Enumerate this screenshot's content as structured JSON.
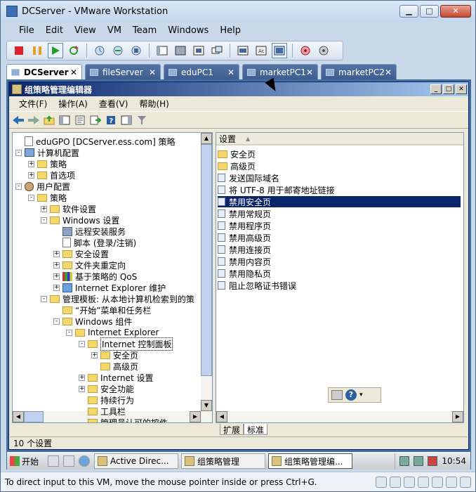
{
  "vmware": {
    "title": "DCServer - VMware Workstation",
    "menu": [
      "File",
      "Edit",
      "View",
      "VM",
      "Team",
      "Windows",
      "Help"
    ],
    "tabs": [
      {
        "label": "DCServer",
        "active": true
      },
      {
        "label": "fileServer",
        "active": false
      },
      {
        "label": "eduPC1",
        "active": false
      },
      {
        "label": "marketPC1",
        "active": false
      },
      {
        "label": "marketPC2",
        "active": false
      }
    ],
    "status_text": "To direct input to this VM, move the mouse pointer inside or press Ctrl+G."
  },
  "mmc": {
    "title": "组策略管理编辑器",
    "menu": [
      "文件(F)",
      "操作(A)",
      "查看(V)",
      "帮助(H)"
    ],
    "tree": [
      {
        "label": "eduGPO [DCServer.ess.com] 策略",
        "level": 0,
        "exp": "",
        "icon": "script"
      },
      {
        "label": "计算机配置",
        "level": 0,
        "exp": "-",
        "icon": "pc"
      },
      {
        "label": "策略",
        "level": 1,
        "exp": "+",
        "icon": "folder"
      },
      {
        "label": "首选项",
        "level": 1,
        "exp": "+",
        "icon": "folder"
      },
      {
        "label": "用户配置",
        "level": 0,
        "exp": "-",
        "icon": "user"
      },
      {
        "label": "策略",
        "level": 1,
        "exp": "-",
        "icon": "folder"
      },
      {
        "label": "软件设置",
        "level": 2,
        "exp": "+",
        "icon": "folder"
      },
      {
        "label": "Windows 设置",
        "level": 2,
        "exp": "-",
        "icon": "folder"
      },
      {
        "label": "远程安装服务",
        "level": 3,
        "exp": "",
        "icon": "gear"
      },
      {
        "label": "脚本 (登录/注销)",
        "level": 3,
        "exp": "",
        "icon": "script"
      },
      {
        "label": "安全设置",
        "level": 3,
        "exp": "+",
        "icon": "folder"
      },
      {
        "label": "文件夹重定向",
        "level": 3,
        "exp": "+",
        "icon": "folder"
      },
      {
        "label": "基于策略的 QoS",
        "level": 3,
        "exp": "+",
        "icon": "chart"
      },
      {
        "label": "Internet Explorer 维护",
        "level": 3,
        "exp": "+",
        "icon": "ie"
      },
      {
        "label": "管理模板: 从本地计算机检索到的策",
        "level": 2,
        "exp": "-",
        "icon": "folder"
      },
      {
        "label": "“开始”菜单和任务栏",
        "level": 3,
        "exp": "",
        "icon": "folder"
      },
      {
        "label": "Windows 组件",
        "level": 3,
        "exp": "-",
        "icon": "folder"
      },
      {
        "label": "Internet Explorer",
        "level": 4,
        "exp": "-",
        "icon": "folder"
      },
      {
        "label": "Internet 控制面板",
        "level": 5,
        "exp": "-",
        "icon": "folder",
        "selected": true
      },
      {
        "label": "安全页",
        "level": 6,
        "exp": "+",
        "icon": "folder"
      },
      {
        "label": "高级页",
        "level": 6,
        "exp": "",
        "icon": "folder"
      },
      {
        "label": "Internet 设置",
        "level": 5,
        "exp": "+",
        "icon": "folder"
      },
      {
        "label": "安全功能",
        "level": 5,
        "exp": "+",
        "icon": "folder"
      },
      {
        "label": "持续行为",
        "level": 5,
        "exp": "",
        "icon": "folder"
      },
      {
        "label": "工具栏",
        "level": 5,
        "exp": "",
        "icon": "folder"
      },
      {
        "label": "管理员认可的控件",
        "level": 5,
        "exp": "",
        "icon": "folder"
      }
    ],
    "column_header": "设置",
    "settings": [
      {
        "label": "安全页",
        "icon": "folder"
      },
      {
        "label": "高级页",
        "icon": "folder"
      },
      {
        "label": "发送国际域名",
        "icon": "policy"
      },
      {
        "label": "将 UTF-8 用于邮寄地址链接",
        "icon": "policy"
      },
      {
        "label": "禁用安全页",
        "icon": "policy",
        "selected": true
      },
      {
        "label": "禁用常规页",
        "icon": "policy"
      },
      {
        "label": "禁用程序页",
        "icon": "policy"
      },
      {
        "label": "禁用高级页",
        "icon": "policy"
      },
      {
        "label": "禁用连接页",
        "icon": "policy"
      },
      {
        "label": "禁用内容页",
        "icon": "policy"
      },
      {
        "label": "禁用隐私页",
        "icon": "policy"
      },
      {
        "label": "阻止忽略证书错误",
        "icon": "policy"
      }
    ],
    "bottom_tabs": [
      "扩展",
      "标准"
    ],
    "status": "10 个设置"
  },
  "taskbar": {
    "start": "开始",
    "tasks": [
      {
        "label": "Active Direc...",
        "active": false
      },
      {
        "label": "组策略管理",
        "active": false
      },
      {
        "label": "组策略管理编...",
        "active": true
      }
    ],
    "clock": "10:54"
  }
}
